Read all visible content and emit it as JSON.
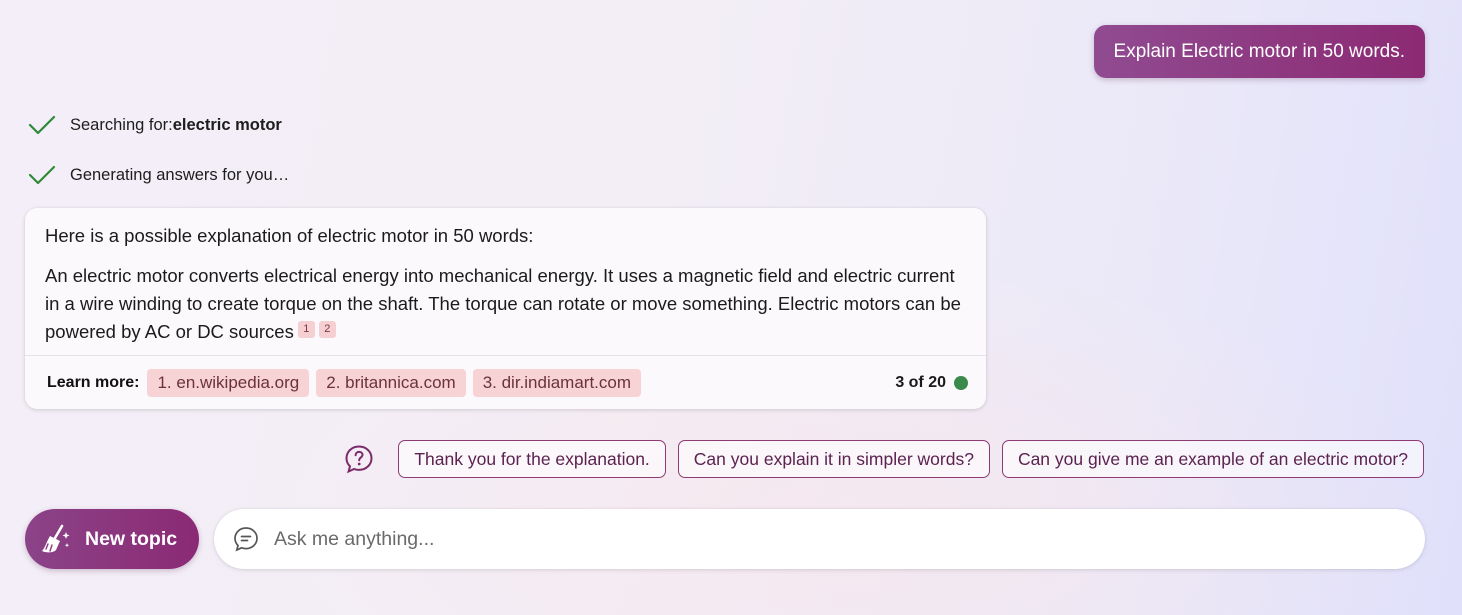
{
  "conversation": {
    "user_message": "Explain Electric motor in 50 words."
  },
  "status": {
    "searching_prefix": "Searching for: ",
    "searching_query": "electric motor",
    "generating": "Generating answers for you…"
  },
  "answer": {
    "intro": "Here is a possible explanation of electric motor in 50 words:",
    "body": "An electric motor converts electrical energy into mechanical energy. It uses a magnetic field and electric current in a wire winding to create torque on the shaft. The torque can rotate or move something. Electric motors can be powered by AC or DC sources",
    "citations": [
      "1",
      "2"
    ],
    "learn_more_label": "Learn more:",
    "links": [
      "1. en.wikipedia.org",
      "2. britannica.com",
      "3. dir.indiamart.com"
    ],
    "page_count": "3 of 20"
  },
  "suggestions": [
    "Thank you for the explanation.",
    "Can you explain it in simpler words?",
    "Can you give me an example of an electric motor?"
  ],
  "composer": {
    "new_topic_label": "New topic",
    "placeholder": "Ask me anything..."
  },
  "colors": {
    "accent": "#8c2a73",
    "citation_bg": "#f7d3d6",
    "check_green": "#2e8b3a",
    "status_dot": "#3a8a4c"
  },
  "icons": {
    "check": "check-icon",
    "suggestion": "help-circle-icon",
    "new_topic": "broom-sparkle-icon",
    "composer": "chat-bubble-icon"
  }
}
